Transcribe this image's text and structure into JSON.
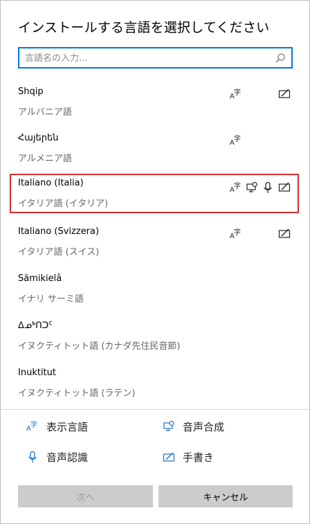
{
  "dialog": {
    "title": "インストールする言語を選択してください"
  },
  "search": {
    "placeholder": "言語名の入力..."
  },
  "languages": [
    {
      "name": "Shqip",
      "localized": "アルバニア語",
      "features": [
        "display-language",
        "handwriting"
      ]
    },
    {
      "name": "Հայերեն",
      "localized": "アルメニア語",
      "features": [
        "display-language"
      ]
    },
    {
      "name": "Italiano (Italia)",
      "localized": "イタリア語 (イタリア)",
      "features": [
        "display-language",
        "speech-synthesis",
        "speech-recognition",
        "handwriting"
      ],
      "selected": true
    },
    {
      "name": "Italiano (Svizzera)",
      "localized": "イタリア語 (スイス)",
      "features": [
        "display-language",
        "handwriting"
      ]
    },
    {
      "name": "Sämikielâ",
      "localized": "イナリ サーミ語",
      "features": []
    },
    {
      "name": "ᐃᓄᒃᑎᑐᑦ",
      "localized": "イヌクティトット語 (カナダ先住民音節)",
      "features": []
    },
    {
      "name": "Inuktitut",
      "localized": "イヌクティトット語 (ラテン)",
      "features": []
    }
  ],
  "legend": {
    "display_language": "表示言語",
    "speech_synthesis": "音声合成",
    "speech_recognition": "音声認識",
    "handwriting": "手書き"
  },
  "buttons": {
    "next": "次へ",
    "cancel": "キャンセル"
  },
  "colors": {
    "accent": "#0078d7",
    "selection_border": "#d32f2f",
    "button_bg": "#cccccc"
  }
}
